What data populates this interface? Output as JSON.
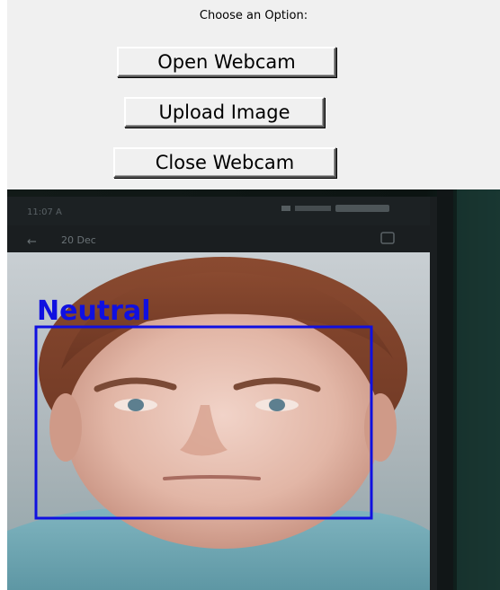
{
  "window": {
    "prompt_label": "Choose an Option:"
  },
  "buttons": {
    "open_webcam": "Open Webcam",
    "upload_image": "Upload Image",
    "close_webcam": "Close Webcam"
  },
  "camera_view": {
    "phone_status_time": "11:07 A",
    "phone_header_date": "20 Dec",
    "detection": {
      "emotion_label": "Neutral",
      "box_color": "#1010e0"
    }
  },
  "colors": {
    "window_bg": "#f0f0f0",
    "detection_blue": "#1010e0"
  }
}
